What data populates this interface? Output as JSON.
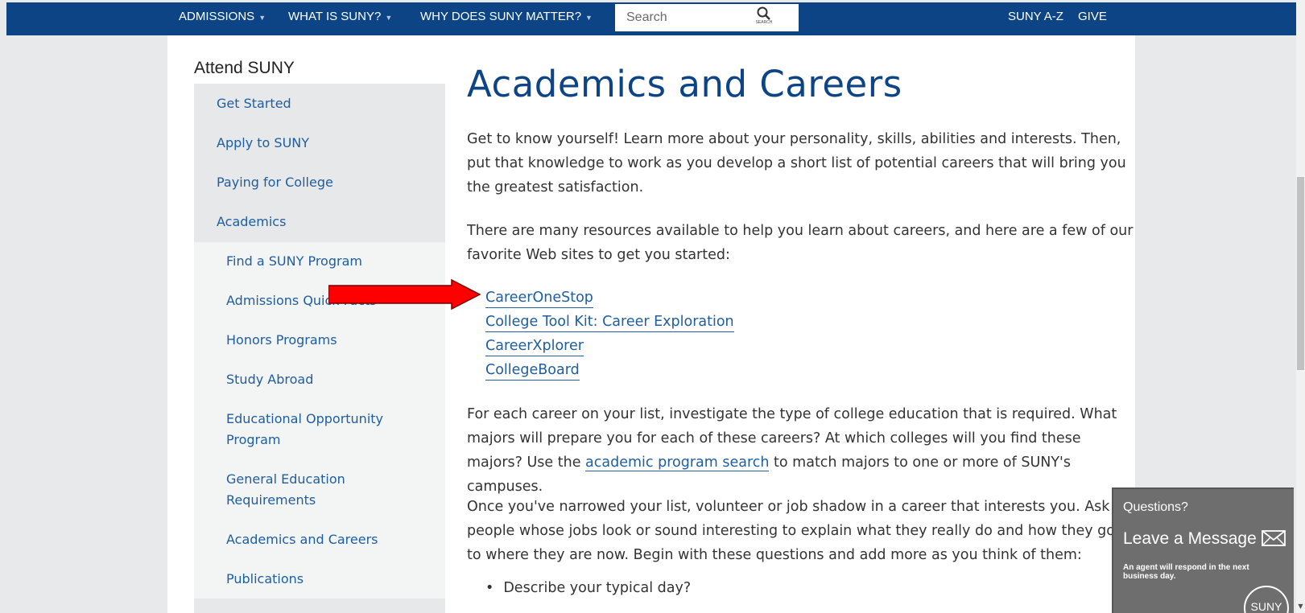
{
  "nav": {
    "items": [
      "ADMISSIONS",
      "WHAT IS SUNY?",
      "WHY DOES SUNY MATTER?"
    ],
    "search_placeholder": "Search",
    "search_caption": "SEARCH",
    "right": [
      "SUNY A-Z",
      "GIVE"
    ]
  },
  "sidebar": {
    "title": "Attend SUNY",
    "items": [
      "Get Started",
      "Apply to SUNY",
      "Paying for College",
      "Academics"
    ],
    "sub_items": [
      "Find a SUNY Program",
      "Admissions Quick Facts",
      "Honors Programs",
      "Study Abroad",
      "Educational Opportunity",
      "Program",
      "General Education",
      "Requirements",
      "Academics and Careers",
      "Publications"
    ]
  },
  "main": {
    "title": "Academics and Careers",
    "intro": "Get to know yourself! Learn more about your personality, skills, abilities and interests. Then, put that knowledge to work as you develop a short list of potential careers that will bring you the greatest satisfaction.",
    "resources_intro": "There are many resources available to help you learn about careers, and here are a few of our favorite Web sites to get you started:",
    "resources": [
      "CareerOneStop",
      "College Tool Kit: Career Exploration",
      "CareerXplorer",
      "CollegeBoard"
    ],
    "para3_before": "For each career on your list, investigate the type of college education that is required. What majors will prepare you for each of these careers? At which colleges will you find these majors? Use the ",
    "para3_link": "academic program search",
    "para3_after": " to match majors to one or more of SUNY's campuses.",
    "para4": "Once you've narrowed your list, volunteer or job shadow in a career that interests you. Ask people whose jobs look or sound interesting to explain what they really do and how they got to where they are now. Begin with these questions and add more as you think of them:",
    "bullets": [
      "Describe your typical day?"
    ]
  },
  "chat": {
    "question": "Questions?",
    "message": "Leave a Message",
    "note": "An agent will respond in the next business day.",
    "logo": "SUNY"
  },
  "colors": {
    "nav_bg": "#0d4485",
    "link": "#1f5ea0",
    "arrow": "#ff0000"
  }
}
